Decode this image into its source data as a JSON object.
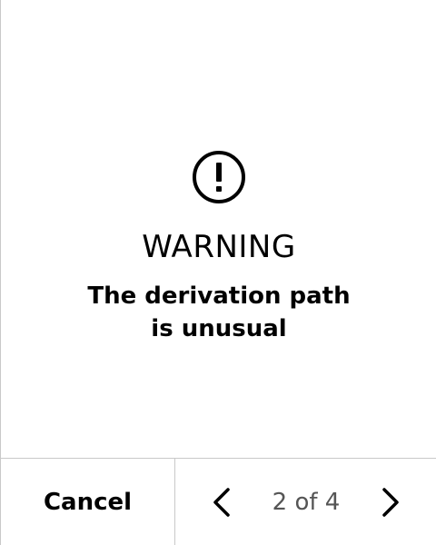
{
  "screen": {
    "icon": "exclamation-circle-icon",
    "title": "WARNING",
    "message_line1": "The derivation path",
    "message_line2": "is unusual"
  },
  "footer": {
    "cancel_label": "Cancel",
    "prev_icon": "chevron-left-icon",
    "next_icon": "chevron-right-icon",
    "page_indicator": "2 of 4",
    "current_page": 2,
    "total_pages": 4
  },
  "colors": {
    "background": "#ffffff",
    "text": "#000000",
    "divider": "#c9c9c9",
    "page_indicator": "#555555"
  }
}
